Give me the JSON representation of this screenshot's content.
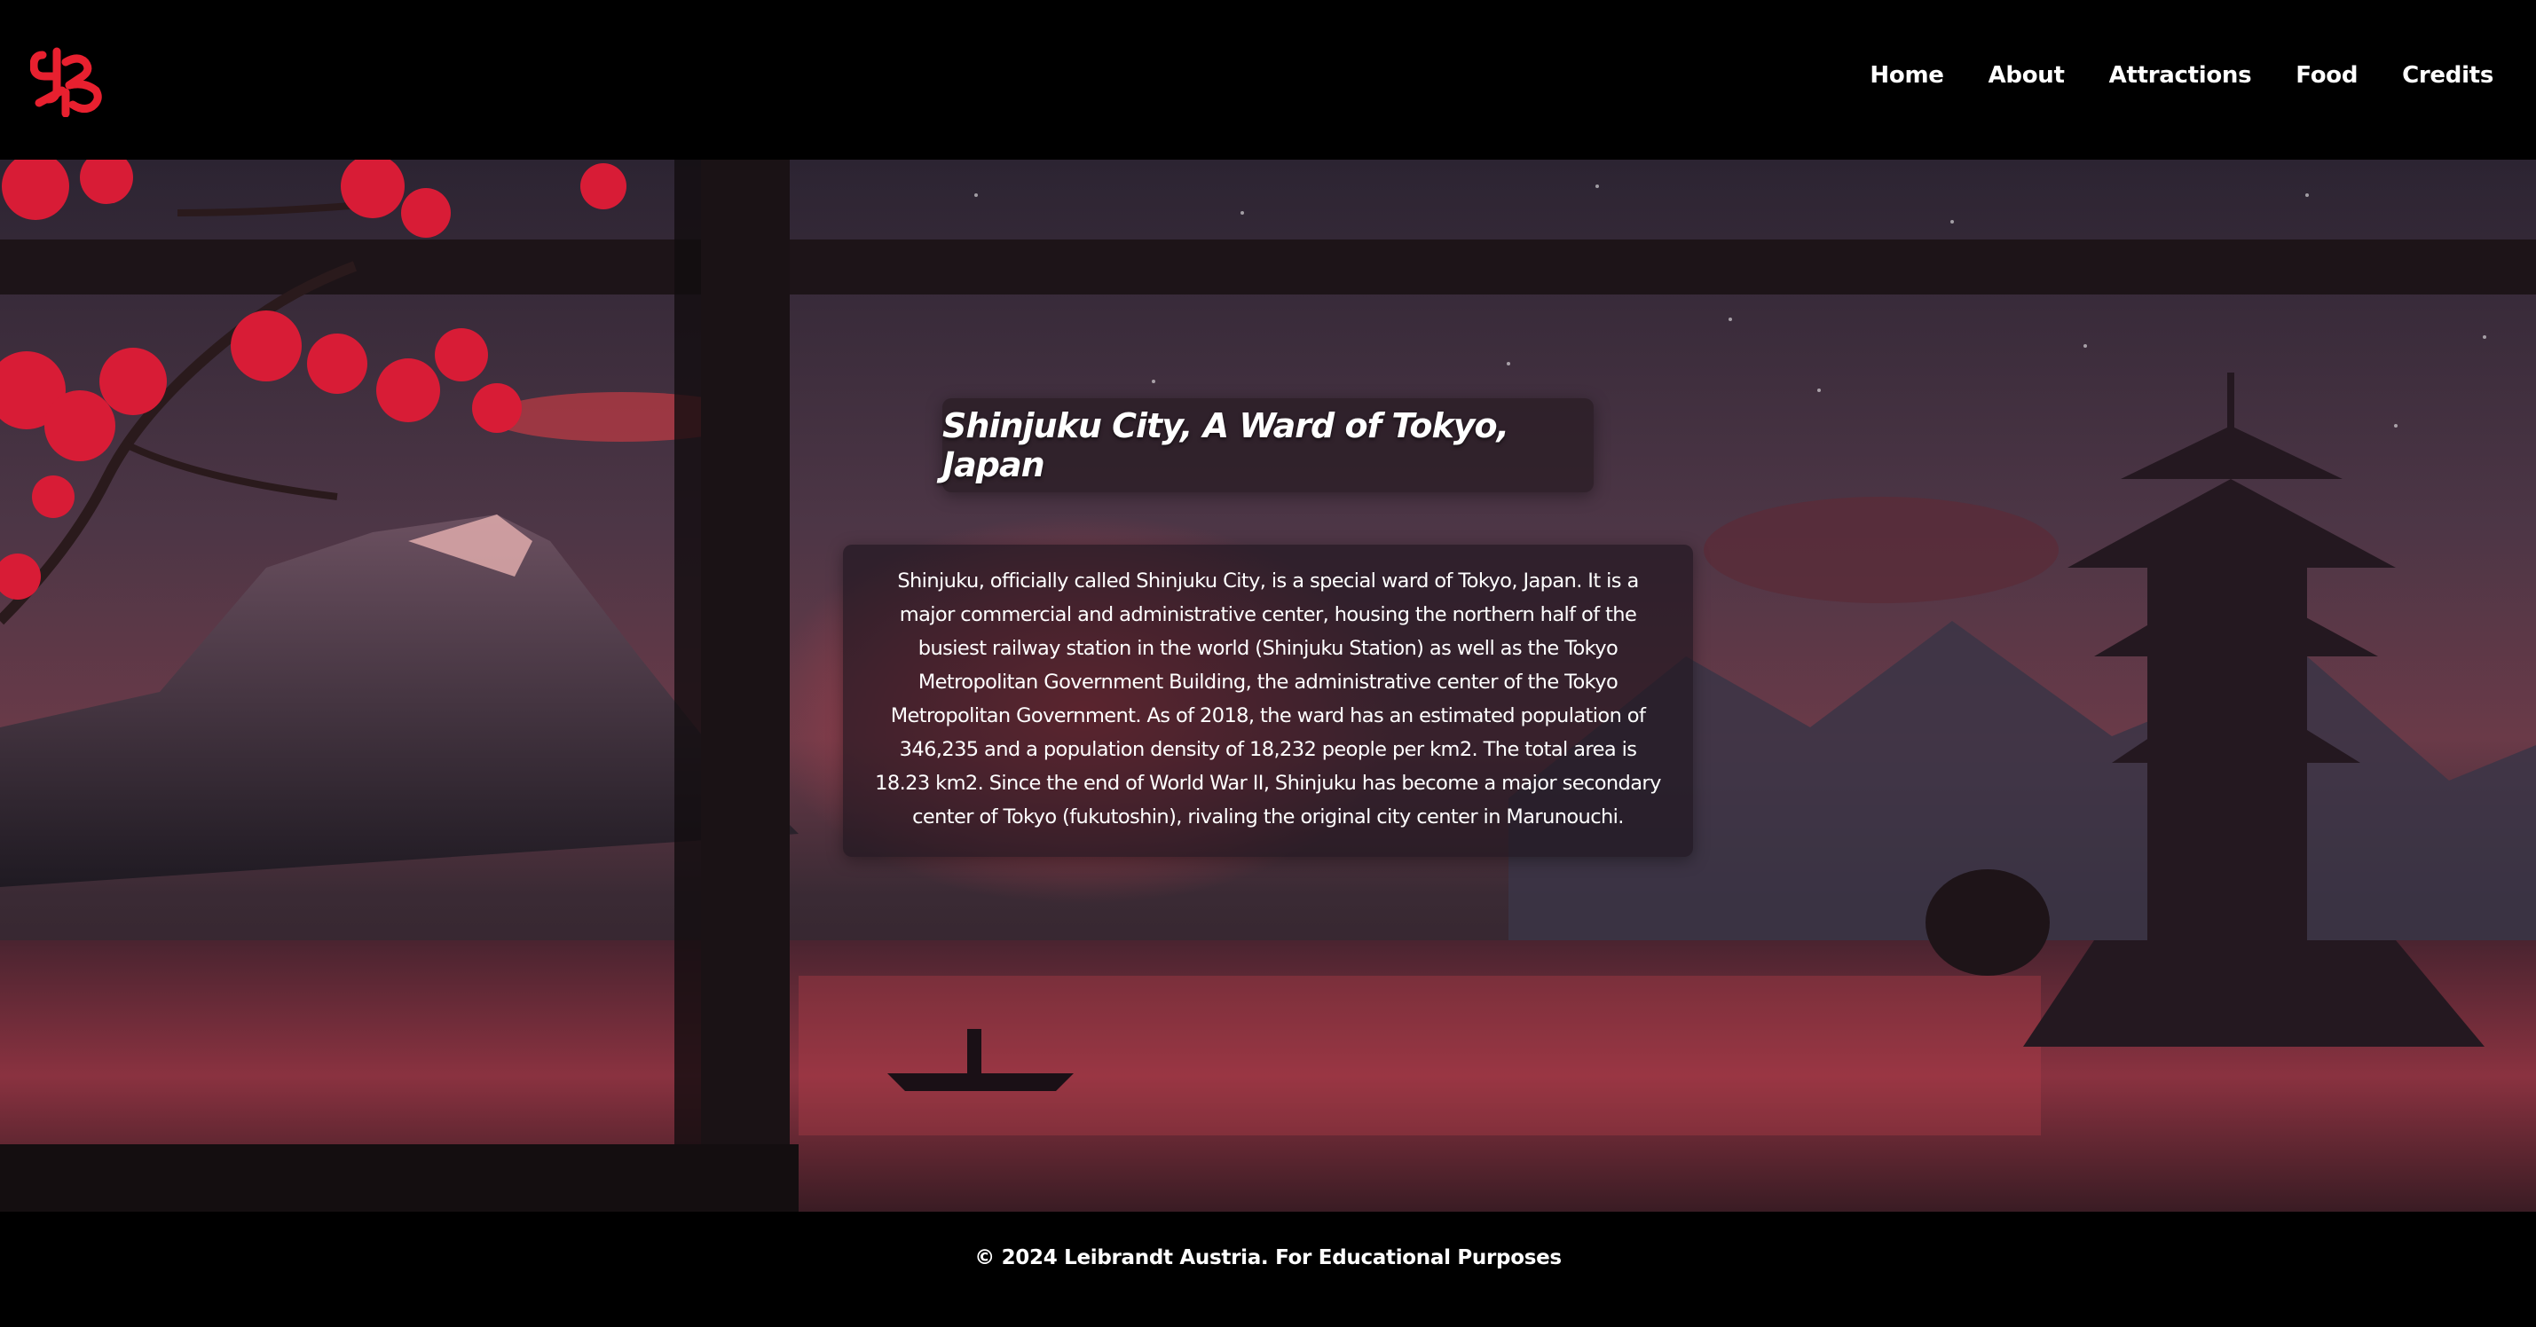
{
  "header": {
    "logo_icon": "stylized-red-kanji-logo-icon",
    "nav": [
      {
        "label": "Home"
      },
      {
        "label": "About"
      },
      {
        "label": "Attractions"
      },
      {
        "label": "Food"
      },
      {
        "label": "Credits"
      }
    ]
  },
  "hero": {
    "background": "night-mountain-pagoda-window-scene",
    "title": "Shinjuku City, A Ward of Tokyo, Japan",
    "description": "Shinjuku, officially called Shinjuku City, is a special ward of Tokyo, Japan. It is a major commercial and administrative center, housing the northern half of the busiest railway station in the world (Shinjuku Station) as well as the Tokyo Metropolitan Government Building, the administrative center of the Tokyo Metropolitan Government. As of 2018, the ward has an estimated population of 346,235 and a population density of 18,232 people per km2. The total area is 18.23 km2. Since the end of World War II, Shinjuku has become a major secondary center of Tokyo (fukutoshin), rivaling the original city center in Marunouchi."
  },
  "footer": {
    "text": "© 2024 Leibrandt Austria. For Educational Purposes"
  },
  "colors": {
    "accent": "#e8202f",
    "header_bg": "#000000",
    "text": "#ffffff"
  }
}
